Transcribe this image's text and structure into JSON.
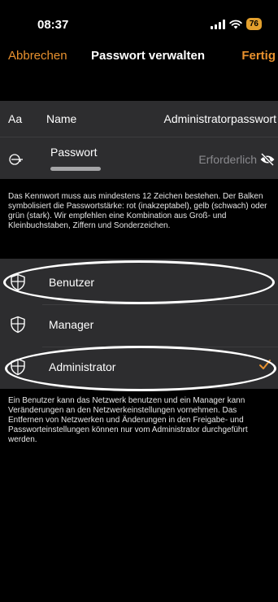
{
  "status_bar": {
    "time": "08:37",
    "battery": "76"
  },
  "nav": {
    "cancel_label": "Abbrechen",
    "title": "Passwort verwalten",
    "done_label": "Fertig"
  },
  "name_row": {
    "prefix": "Aa",
    "label": "Name",
    "value": "Administratorpasswort"
  },
  "password_row": {
    "label": "Passwort",
    "placeholder": "Erforderlich",
    "icon": "eye-slash-icon"
  },
  "password_hint": "Das Kennwort muss aus mindestens 12 Zeichen bestehen. Der Balken symbolisiert die Passwortstärke: rot (inakzeptabel), gelb (schwach) oder grün (stark). Wir empfehlen eine Kombination aus Groß- und Kleinbuchstaben, Ziffern und Sonderzeichen.",
  "roles": [
    {
      "label": "Benutzer",
      "icon": "shield-icon",
      "selected": false
    },
    {
      "label": "Manager",
      "icon": "shield-icon",
      "selected": false
    },
    {
      "label": "Administrator",
      "icon": "shield-icon",
      "selected": true
    }
  ],
  "roles_hint": "Ein Benutzer kann das Netzwerk benutzen und ein Manager kann Veränderungen an den Netzwerkeinstellungen vornehmen. Das Entfernen von Netzwerken und Änderungen in den Freigabe- und Passworteinstellungen können nur vom Administrator durchgeführt werden.",
  "colors": {
    "accent": "#e8912e",
    "cell": "#2d2d2f",
    "background": "#000000"
  }
}
